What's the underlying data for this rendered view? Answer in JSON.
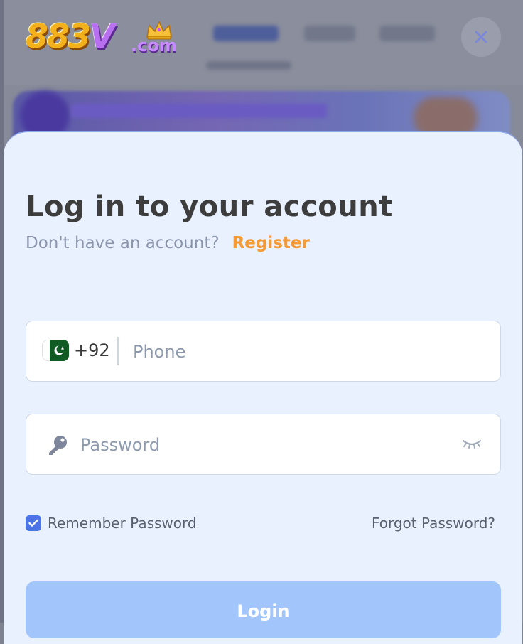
{
  "brand": {
    "logo_main": "883",
    "logo_v": "V",
    "logo_suffix": ".com"
  },
  "icons": {
    "close": "close-icon",
    "flag": "pakistan-flag-icon",
    "key": "key-icon",
    "eye": "eye-closed-icon",
    "check": "check-icon"
  },
  "login": {
    "title": "Log in to your account",
    "no_account_text": "Don't have an account?",
    "register_link": "Register",
    "country_code": "+92",
    "phone_placeholder": "Phone",
    "password_placeholder": "Password",
    "remember_label": "Remember Password",
    "remember_checked": true,
    "forgot_link": "Forgot Password?",
    "login_button": "Login"
  },
  "colors": {
    "accent": "#f59a35",
    "primary": "#4c74e6",
    "button": "#a2c5fb",
    "sheet": "#e9f1fe"
  }
}
